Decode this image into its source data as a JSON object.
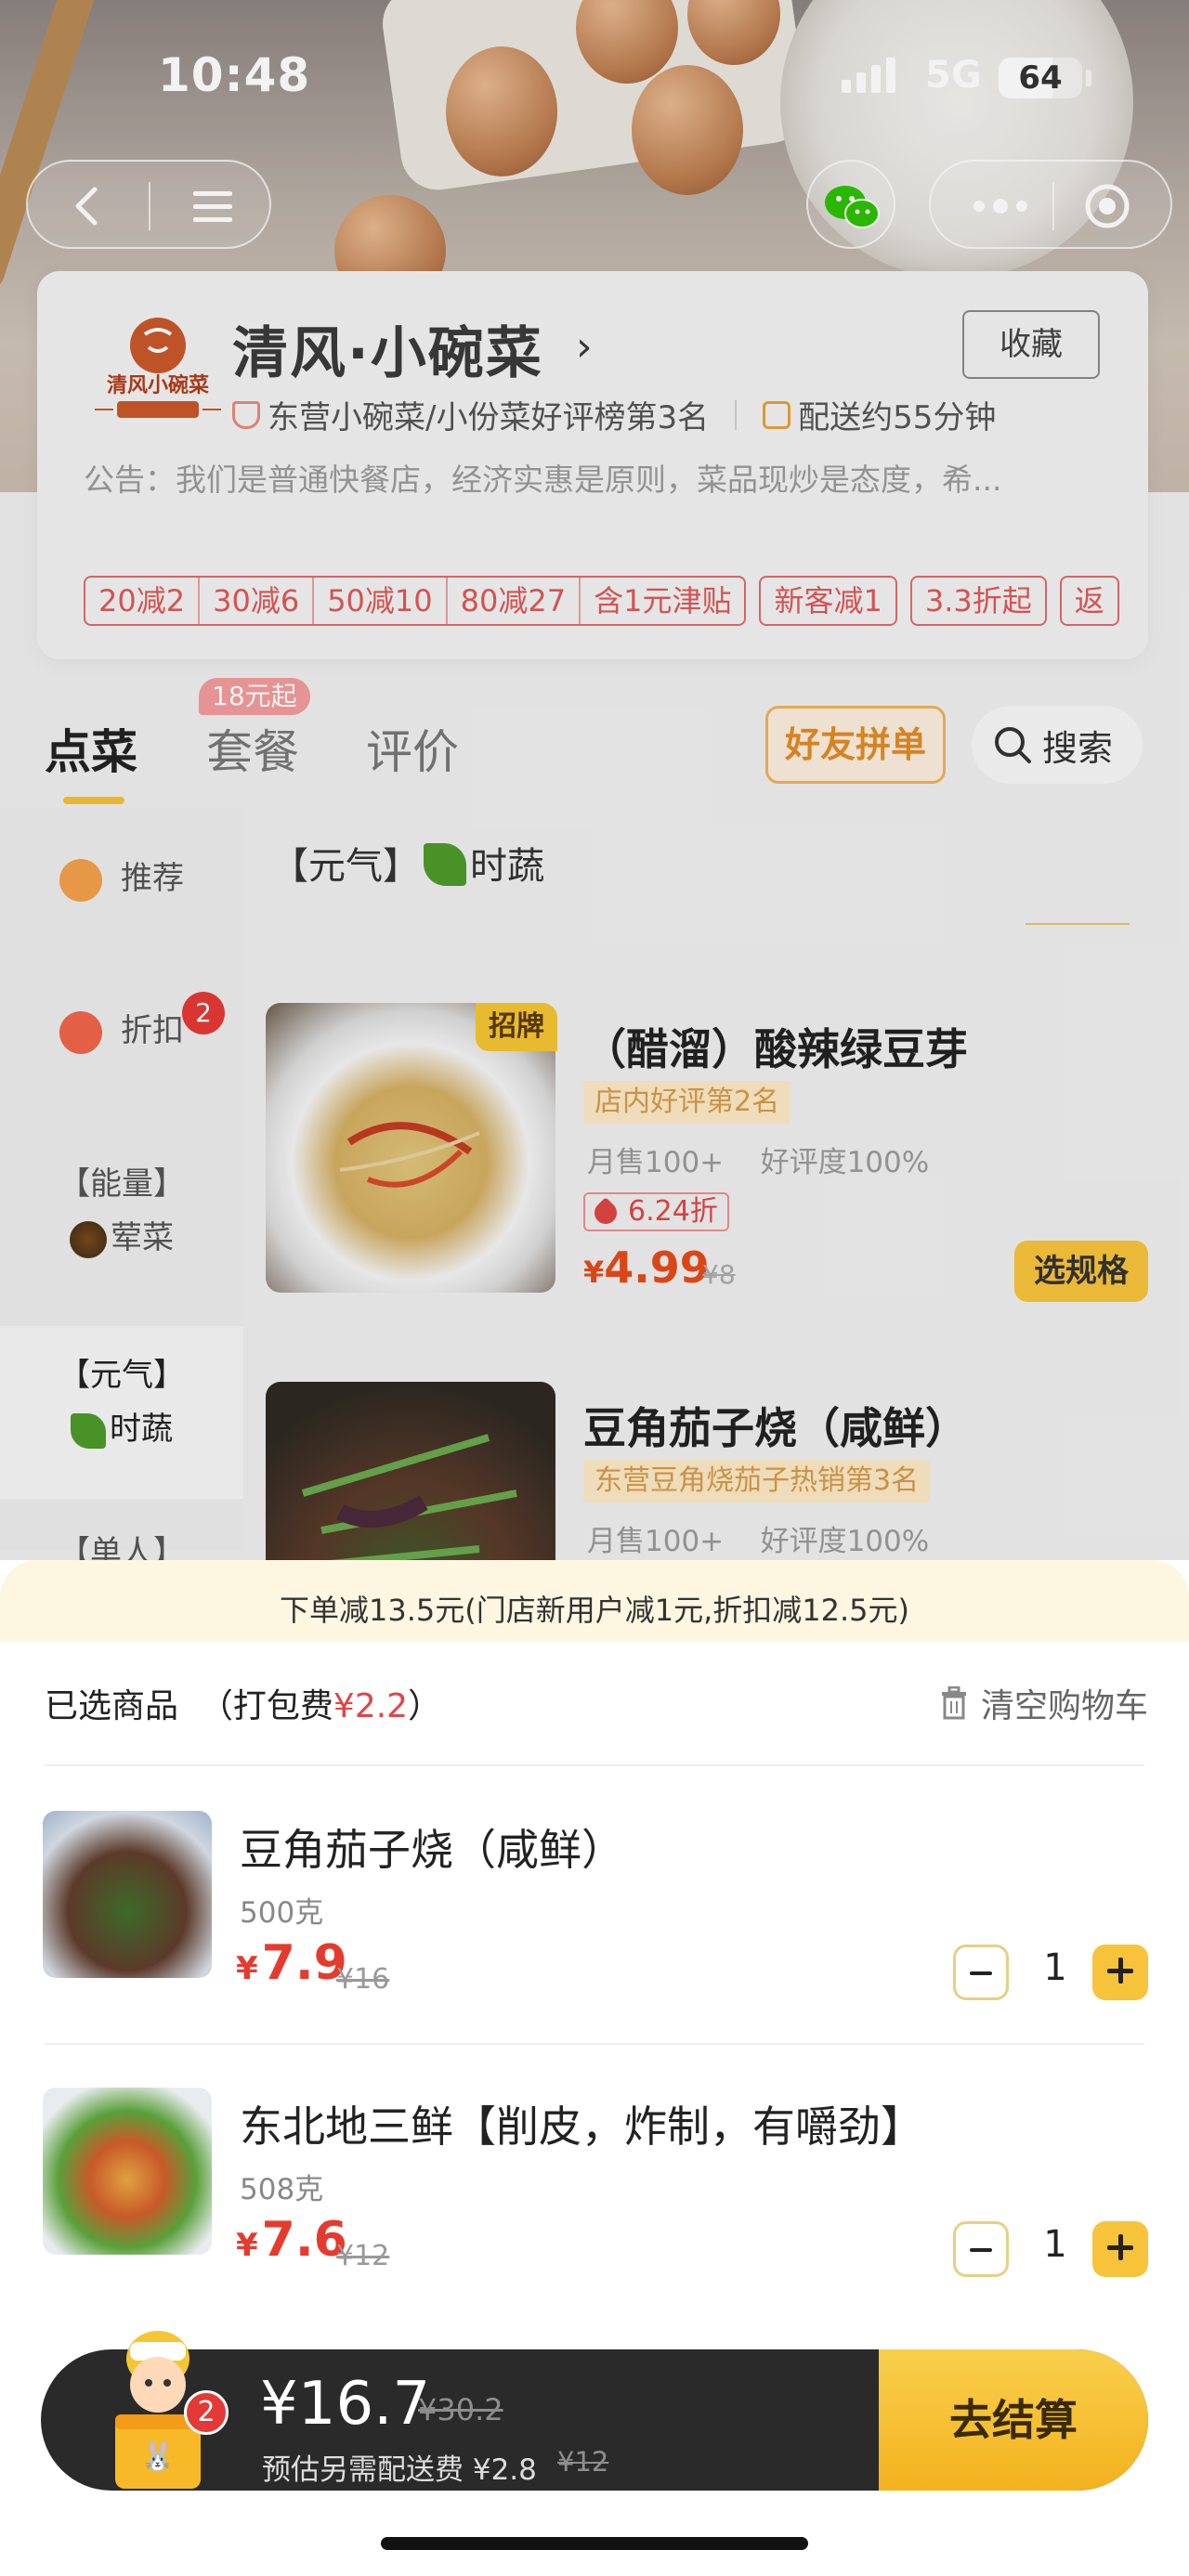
{
  "status": {
    "time": "10:48",
    "network": "5G",
    "battery": "64",
    "battery_level": 0.64
  },
  "store": {
    "name": "清风·小碗菜",
    "favorite_label": "收藏",
    "rank_text": "东营小碗菜/小份菜好评榜第3名",
    "delivery_text": "配送约55分钟",
    "notice": "公告：我们是普通快餐店，经济实惠是原则，菜品现炒是态度，希...",
    "discount_tiers": [
      "20减2",
      "30减6",
      "50减10",
      "80减27",
      "含1元津贴"
    ],
    "tags": [
      "新客减1",
      "3.3折起",
      "返"
    ]
  },
  "tabs": [
    {
      "label": "点菜",
      "active": true
    },
    {
      "label": "套餐",
      "badge": "18元起"
    },
    {
      "label": "评价"
    }
  ],
  "friend_button": "好友拼单",
  "search_label": "搜索",
  "sidebar": [
    {
      "label": "推荐",
      "icon": "bookmark-icon"
    },
    {
      "label": "折扣",
      "icon": "discount-icon",
      "badge": "2"
    },
    {
      "label_top": "【能量】",
      "label_bottom": "荤菜",
      "icon": "meat-dish-icon"
    },
    {
      "label_top": "【元气】",
      "label_bottom": "时蔬",
      "icon": "leaf-icon",
      "active": true
    },
    {
      "label_top": "【单人】"
    }
  ],
  "category_title": "【元气】",
  "category_title_suffix": "时蔬",
  "products": [
    {
      "name": "（醋溜）酸辣绿豆芽",
      "badge": "招牌",
      "rank": "店内好评第2名",
      "sales": "月售100+",
      "rating": "好评度100%",
      "discount": "6.24折",
      "currency": "¥",
      "price": "4.99",
      "original": "¥8",
      "spec_button": "选规格"
    },
    {
      "name": "豆角茄子烧（咸鲜）",
      "rank": "东营豆角烧茄子热销第3名",
      "sales": "月售100+",
      "rating": "好评度100%"
    }
  ],
  "cart_sheet": {
    "promo": "下单减13.5元(门店新用户减1元,折扣减12.5元)",
    "selected_label": "已选商品",
    "packing_prefix": "（打包费",
    "packing_fee": "¥2.2",
    "packing_suffix": "）",
    "clear_label": "清空购物车",
    "items": [
      {
        "name": "豆角茄子烧（咸鲜）",
        "weight": "500克",
        "currency": "¥",
        "price": "7.9",
        "original": "¥16",
        "qty": "1"
      },
      {
        "name": "东北地三鲜【削皮，炸制，有嚼劲】",
        "weight": "508克",
        "currency": "¥",
        "price": "7.6",
        "original": "¥12",
        "qty": "1"
      }
    ]
  },
  "checkout_bar": {
    "total": "¥16.7",
    "total_original": "¥30.2",
    "delivery_fee": "预估另需配送费 ¥2.8",
    "delivery_original": "¥12",
    "cart_count": "2",
    "checkout_label": "去结算"
  },
  "colors": {
    "accent": "#f7c33a",
    "price_red": "#e53b2f",
    "bar_dark": "#2a2a2a"
  }
}
